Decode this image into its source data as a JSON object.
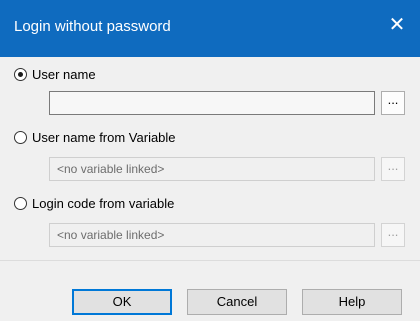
{
  "window": {
    "title": "Login without password",
    "close_symbol": "✕"
  },
  "options": [
    {
      "label": "User name",
      "selected": true,
      "field_value": "",
      "field_enabled": true
    },
    {
      "label": "User name from Variable",
      "selected": false,
      "field_value": "<no variable linked>",
      "field_enabled": false
    },
    {
      "label": "Login code from variable",
      "selected": false,
      "field_value": "<no variable linked>",
      "field_enabled": false
    }
  ],
  "browse_label": "...",
  "buttons": {
    "ok": "OK",
    "cancel": "Cancel",
    "help": "Help"
  },
  "colors": {
    "titlebar": "#0f6bbf",
    "default_button_border": "#0078d7"
  }
}
